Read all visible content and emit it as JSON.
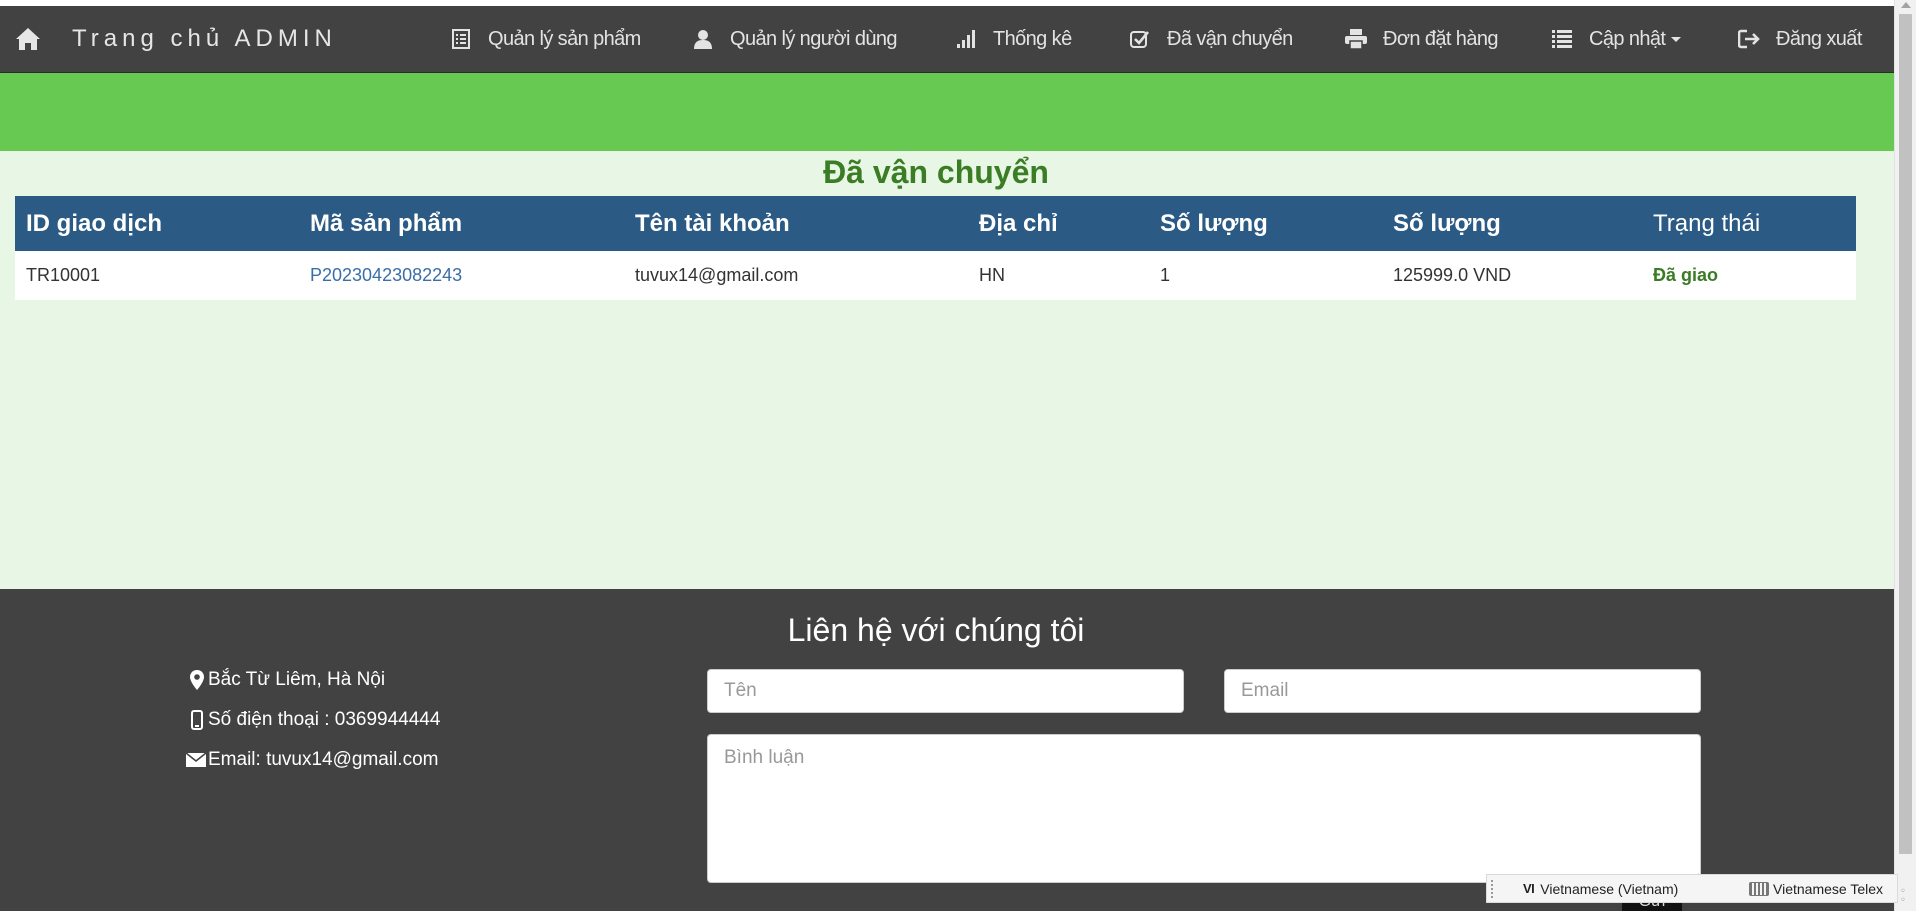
{
  "navbar": {
    "brand": "Trang chủ ADMIN",
    "items": [
      {
        "label": "Quản lý sản phẩm",
        "icon": "list-alt-icon"
      },
      {
        "label": "Quản lý người dùng",
        "icon": "user-icon"
      },
      {
        "label": "Thống kê",
        "icon": "signal-icon"
      },
      {
        "label": "Đã vận chuyển",
        "icon": "check-icon"
      },
      {
        "label": "Đơn đặt hàng",
        "icon": "print-icon"
      },
      {
        "label": "Cập nhật",
        "icon": "list-icon"
      },
      {
        "label": "Đăng xuất",
        "icon": "log-out-icon"
      }
    ]
  },
  "page": {
    "title": "Đã vận chuyển"
  },
  "table": {
    "headers": [
      "ID giao dịch",
      "Mã sản phẩm",
      "Tên tài khoản",
      "Địa chỉ",
      "Số lượng",
      "Số lượng",
      "Trạng thái"
    ],
    "rows": [
      [
        "TR10001",
        "P20230423082243",
        "tuvux14@gmail.com",
        "HN",
        "1",
        "125999.0 VND",
        "Đã giao"
      ]
    ]
  },
  "footer": {
    "title": "Liên hệ với chúng tôi",
    "address": "Bắc Từ Liêm, Hà Nội",
    "phone": "Số điện thoại : 0369944444",
    "email": "Email: tuvux14@gmail.com",
    "name_placeholder": "Tên",
    "email_placeholder": "Email",
    "comment_placeholder": "Bình luận",
    "send_label": "Gửi"
  },
  "ime": {
    "code": "VI",
    "language": "Vietnamese (Vietnam)",
    "keyboard": "Vietnamese Telex"
  },
  "colors": {
    "navbar": "#424242",
    "green_band": "#67c952",
    "content_bg": "#e8f6e5",
    "table_header": "#2b5a84",
    "title_green": "#3a7d24",
    "link": "#3a6ea8"
  }
}
